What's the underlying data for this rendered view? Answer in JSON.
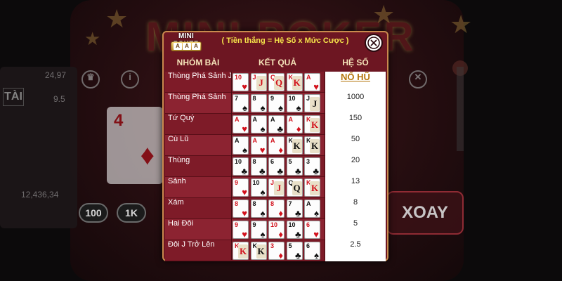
{
  "background": {
    "title": "MINI POKER",
    "side_numbers": [
      "24,97",
      "9.5",
      "12,436,34"
    ],
    "tai_label": "TÀI",
    "chips": [
      "100",
      "1K"
    ],
    "icons": [
      "trophy-icon",
      "info-icon",
      "close-icon"
    ],
    "spin_label": "XOAY",
    "card_rank": "4",
    "card_suit": "♦"
  },
  "dialog": {
    "logo_text": "MINI POKER",
    "logo_letters": [
      "A",
      "A",
      "A"
    ],
    "formula": "( Tiền thắng = Hệ Số x Mức Cược )",
    "close_icon": "close-icon",
    "headers": {
      "hand": "NHÓM BÀI",
      "result": "KẾT QUẢ",
      "multiplier": "HỆ SỐ"
    },
    "rows": [
      {
        "hand": "Thùng Phá Sảnh J",
        "multiplier": "NỔ HŨ",
        "jackpot": true,
        "cards": [
          {
            "r": "10",
            "s": "♥"
          },
          {
            "r": "J",
            "s": "♥"
          },
          {
            "r": "Q",
            "s": "♥"
          },
          {
            "r": "K",
            "s": "♥"
          },
          {
            "r": "A",
            "s": "♥"
          }
        ]
      },
      {
        "hand": "Thùng Phá Sảnh",
        "multiplier": "1000",
        "cards": [
          {
            "r": "7",
            "s": "♠"
          },
          {
            "r": "8",
            "s": "♠"
          },
          {
            "r": "9",
            "s": "♠"
          },
          {
            "r": "10",
            "s": "♠"
          },
          {
            "r": "J",
            "s": "♠"
          }
        ]
      },
      {
        "hand": "Tứ Quý",
        "multiplier": "150",
        "cards": [
          {
            "r": "A",
            "s": "♥"
          },
          {
            "r": "A",
            "s": "♠"
          },
          {
            "r": "A",
            "s": "♣"
          },
          {
            "r": "A",
            "s": "♦"
          },
          {
            "r": "K",
            "s": "♥"
          }
        ]
      },
      {
        "hand": "Cù Lũ",
        "multiplier": "50",
        "cards": [
          {
            "r": "A",
            "s": "♠"
          },
          {
            "r": "A",
            "s": "♥"
          },
          {
            "r": "A",
            "s": "♦"
          },
          {
            "r": "K",
            "s": "♠"
          },
          {
            "r": "K",
            "s": "♣"
          }
        ]
      },
      {
        "hand": "Thùng",
        "multiplier": "20",
        "cards": [
          {
            "r": "10",
            "s": "♣"
          },
          {
            "r": "8",
            "s": "♣"
          },
          {
            "r": "6",
            "s": "♣"
          },
          {
            "r": "5",
            "s": "♣"
          },
          {
            "r": "3",
            "s": "♣"
          }
        ]
      },
      {
        "hand": "Sảnh",
        "multiplier": "13",
        "cards": [
          {
            "r": "9",
            "s": "♥"
          },
          {
            "r": "10",
            "s": "♠"
          },
          {
            "r": "J",
            "s": "♦"
          },
          {
            "r": "Q",
            "s": "♣"
          },
          {
            "r": "K",
            "s": "♥"
          }
        ]
      },
      {
        "hand": "Xám",
        "multiplier": "8",
        "cards": [
          {
            "r": "8",
            "s": "♥"
          },
          {
            "r": "8",
            "s": "♠"
          },
          {
            "r": "8",
            "s": "♦"
          },
          {
            "r": "7",
            "s": "♣"
          },
          {
            "r": "A",
            "s": "♠"
          }
        ]
      },
      {
        "hand": "Hai Đôi",
        "multiplier": "5",
        "cards": [
          {
            "r": "9",
            "s": "♥"
          },
          {
            "r": "9",
            "s": "♠"
          },
          {
            "r": "10",
            "s": "♦"
          },
          {
            "r": "10",
            "s": "♣"
          },
          {
            "r": "6",
            "s": "♥"
          }
        ]
      },
      {
        "hand": "Đôi J Trở Lên",
        "multiplier": "2.5",
        "cards": [
          {
            "r": "K",
            "s": "♥"
          },
          {
            "r": "K",
            "s": "♠"
          },
          {
            "r": "3",
            "s": "♦"
          },
          {
            "r": "5",
            "s": "♣"
          },
          {
            "r": "6",
            "s": "♠"
          }
        ]
      }
    ]
  },
  "colors": {
    "dialog_bg": "#6d1622",
    "accent_gold": "#c98a4e",
    "formula_yellow": "#f4e24a",
    "card_red": "#d2111c",
    "jackpot": "#b5760c"
  }
}
